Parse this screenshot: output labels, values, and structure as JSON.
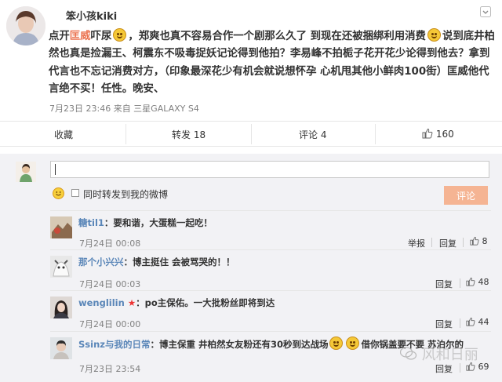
{
  "post": {
    "username": "笨小孩kiki",
    "text": {
      "part1": "点开",
      "highlight": "匡威",
      "part2": "吓尿",
      "part3": "，郑爽也真不容易合作一个剧那么久了 到现在还被捆绑利用消费",
      "part4": "说到底井柏然也真是捡漏王、柯震东不吸毒捉妖记论得到他拍？李易峰不拍栀子花开花少论得到他去？拿到代言也不忘记消费对方，（印象最深花少有机会就说想怀孕 心机甩其他小鲜肉100街）匡威他代言绝不买！任性。晚安、"
    },
    "meta": "7月23日 23:46 来自 三星GALAXY S4",
    "actions": {
      "favorite": "收藏",
      "repost": "转发 18",
      "comment": "评论 4",
      "like": "160"
    }
  },
  "composer": {
    "repost_label": "同时转发到我的微博",
    "submit_label": "评论"
  },
  "comments": [
    {
      "name": "糖til1",
      "text": "：要和谐，大蛋糕一起吃！",
      "time": "7月24日 00:08",
      "report": "举报",
      "reply": "回复",
      "likes": "8"
    },
    {
      "name": "那个小兴兴",
      "text": "：博主挺住 会被骂哭的！！",
      "time": "7月24日 00:03",
      "reply": "回复",
      "likes": "48"
    },
    {
      "name": "wenglilin",
      "text": "：po主保佑。一大批粉丝即将到达",
      "time": "7月24日 00:00",
      "reply": "回复",
      "likes": "44"
    },
    {
      "name": "Ssinz与我的日常",
      "text1": "：博主保重 井柏然女友粉还有30秒到达战场",
      "text2": "借你锅盖要不要 苏泊尔的",
      "time": "7月23日 23:54",
      "reply": "回复",
      "likes": "69"
    }
  ],
  "watermark": "风和日丽",
  "colors": {
    "link": "#5a86b8",
    "highlight": "#eb7350",
    "submit": "#f5b493"
  }
}
